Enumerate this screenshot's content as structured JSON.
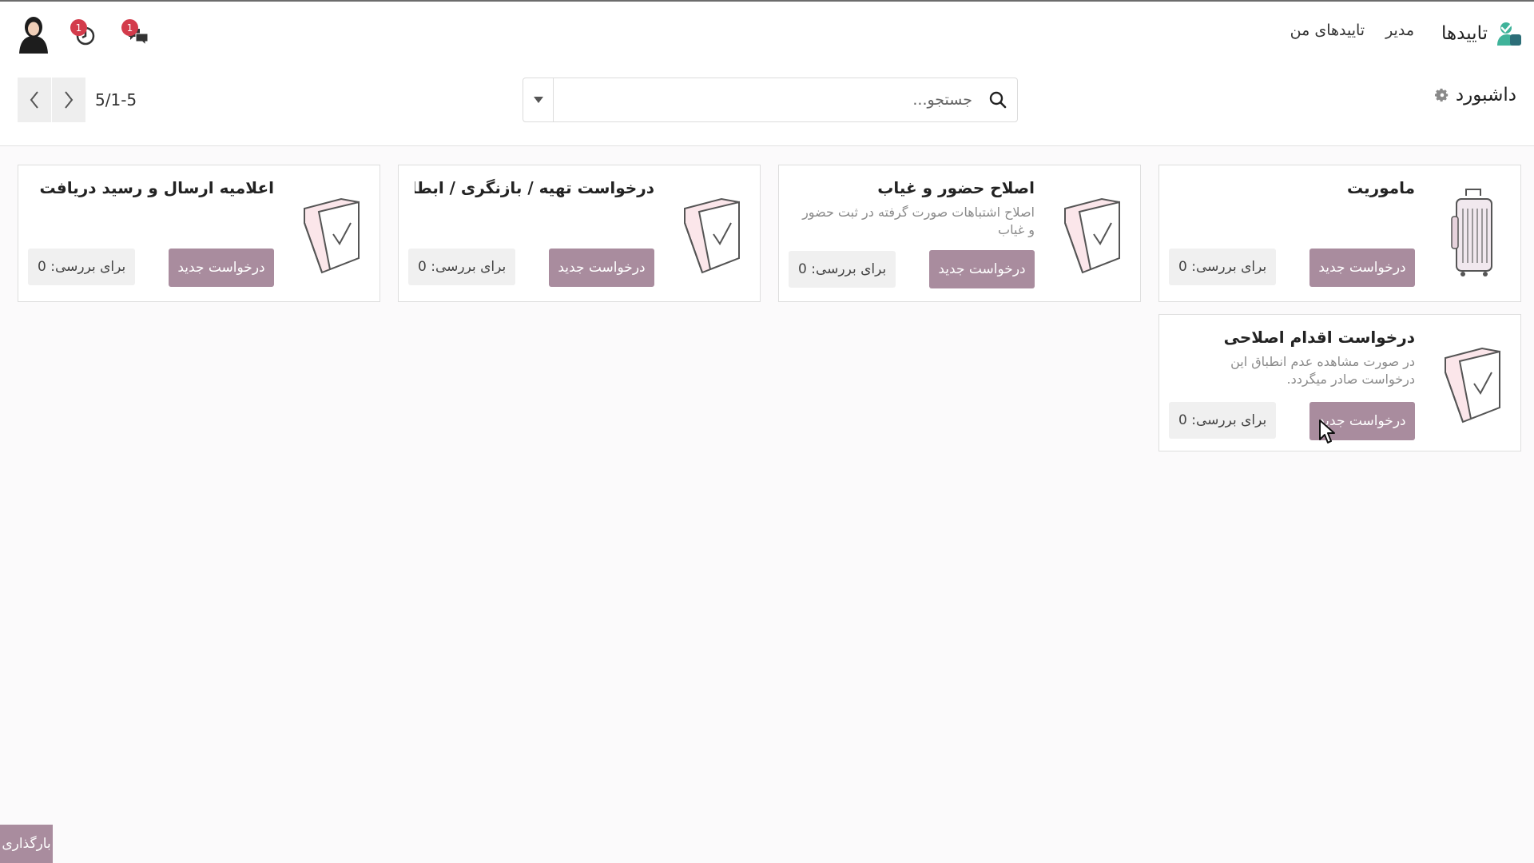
{
  "navbar": {
    "app_title": "تاییدها",
    "menu": [
      "تاییدهای من",
      "مدیر"
    ],
    "activity_badge": "1",
    "messages_badge": "1"
  },
  "control_panel": {
    "breadcrumb": "داشبورد",
    "search_placeholder": "جستجو...",
    "pager": "5/1-5"
  },
  "cards": [
    {
      "title": "ماموریت",
      "description": "",
      "button": "درخواست جدید",
      "review": "برای بررسی: 0",
      "icon": "suitcase-icon"
    },
    {
      "title": "اصلاح حضور و غیاب",
      "description": "اصلاح اشتباهات صورت گرفته در ثبت حضور و غیاب",
      "button": "درخواست جدید",
      "review": "برای بررسی: 0",
      "icon": "folder-check-icon"
    },
    {
      "title": "درخواست تهیه / بازنگری / ابطال م...",
      "description": "",
      "button": "درخواست جدید",
      "review": "برای بررسی: 0",
      "icon": "folder-check-icon"
    },
    {
      "title": "اعلامیه ارسال و رسید دریافت",
      "description": "",
      "button": "درخواست جدید",
      "review": "برای بررسی: 0",
      "icon": "folder-check-icon"
    },
    {
      "title": "درخواست اقدام اصلاحی",
      "description": "در صورت مشاهده عدم انطباق این درخواست صادر میگردد.",
      "button": "درخواست جدید",
      "review": "برای بررسی: 0",
      "icon": "folder-check-icon"
    }
  ],
  "footer": {
    "load_button": "بارگذاری"
  },
  "colors": {
    "primary": "#a98c9e",
    "badge": "#d33b4b",
    "brand": "#3fb39a"
  }
}
